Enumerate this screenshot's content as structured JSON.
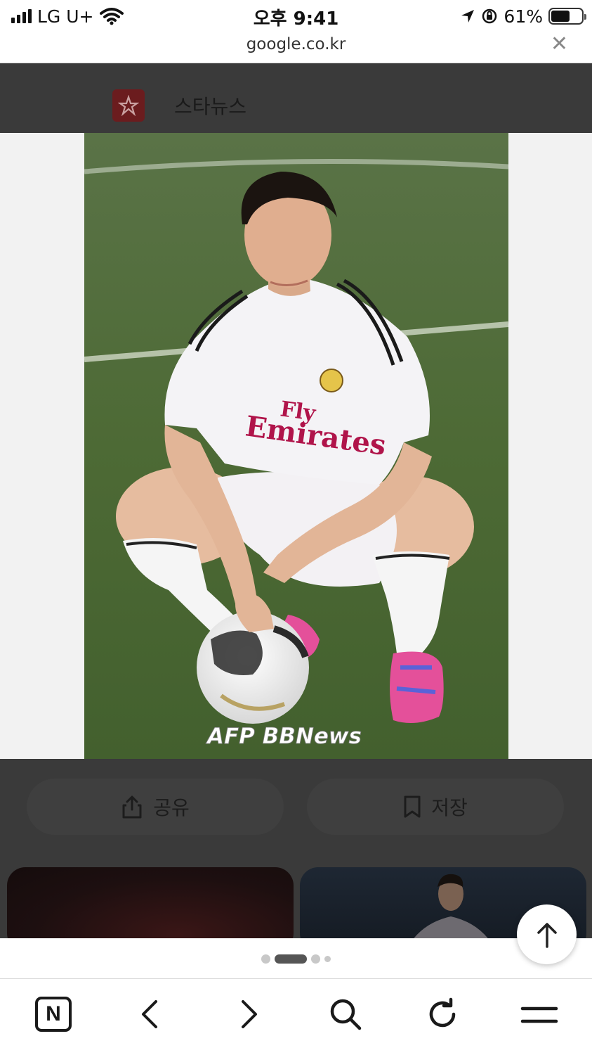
{
  "status_bar": {
    "carrier": "LG U+",
    "time": "오후 9:41",
    "battery_percent": "61%",
    "battery_level": 0.61
  },
  "url_bar": {
    "domain": "google.co.kr",
    "close_label": "✕"
  },
  "source": {
    "name": "스타뉴스",
    "logo_color": "#6b1c1e"
  },
  "image": {
    "watermark": "AFP BBNews",
    "jersey_text_1": "Fly",
    "jersey_text_2": "Emirates"
  },
  "actions": {
    "share_label": "공유",
    "save_label": "저장"
  },
  "pager": {
    "dot_count": 4,
    "active_index": 1
  },
  "toolbar": {
    "home_label": "N",
    "items": [
      "naver-home-icon",
      "back-icon",
      "forward-icon",
      "search-icon",
      "reload-icon",
      "menu-icon"
    ]
  }
}
